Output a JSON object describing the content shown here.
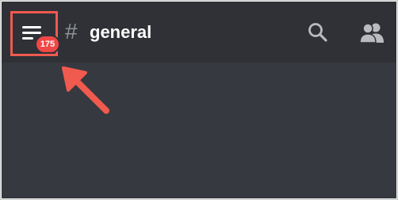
{
  "header": {
    "menu_button": {
      "unread_count": "175",
      "icon": "hamburger-menu-icon"
    },
    "channel": {
      "hash": "#",
      "name": "general"
    },
    "actions": [
      {
        "icon": "search-icon"
      },
      {
        "icon": "members-icon"
      }
    ]
  },
  "annotation": {
    "highlight_color": "#f05a4f",
    "arrow_color": "#f05a4f"
  },
  "colors": {
    "background": "#36393f",
    "header": "#2f3136",
    "badge": "#f04747"
  }
}
